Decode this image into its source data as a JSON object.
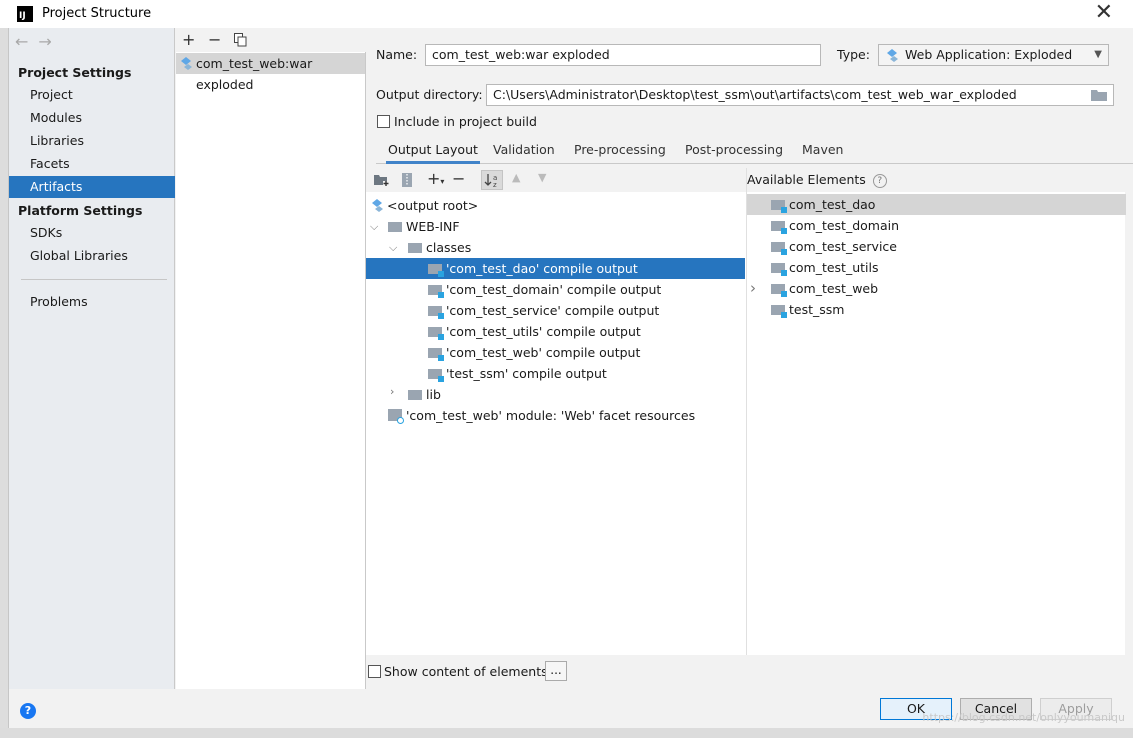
{
  "window": {
    "title": "Project Structure",
    "app_icon_text": "IJ",
    "close_glyph": "✕"
  },
  "sidebar": {
    "nav_back": "←",
    "nav_forward": "→",
    "project_settings_header": "Project Settings",
    "project_items": [
      {
        "label": "Project"
      },
      {
        "label": "Modules"
      },
      {
        "label": "Libraries"
      },
      {
        "label": "Facets"
      },
      {
        "label": "Artifacts",
        "selected": true
      }
    ],
    "platform_settings_header": "Platform Settings",
    "platform_items": [
      {
        "label": "SDKs"
      },
      {
        "label": "Global Libraries"
      }
    ],
    "problems_label": "Problems"
  },
  "artifacts": {
    "add": "+",
    "remove": "−",
    "copy_icon": "copy-icon",
    "items": [
      {
        "label": "com_test_web:war exploded"
      }
    ]
  },
  "details": {
    "name_label": "Name:",
    "name_value": "com_test_web:war exploded",
    "type_label": "Type:",
    "type_value": "Web Application: Exploded",
    "output_dir_label": "Output directory:",
    "output_dir_value": "C:\\Users\\Administrator\\Desktop\\test_ssm\\out\\artifacts\\com_test_web_war_exploded",
    "include_in_build_label": "Include in project build",
    "include_in_build_checked": false
  },
  "tabs": [
    {
      "label": "Output Layout",
      "active": true
    },
    {
      "label": "Validation"
    },
    {
      "label": "Pre-processing"
    },
    {
      "label": "Post-processing"
    },
    {
      "label": "Maven"
    }
  ],
  "layout_tree": {
    "root": "<output root>",
    "web_inf": "WEB-INF",
    "classes": "classes",
    "outputs": [
      {
        "label": "'com_test_dao' compile output",
        "selected": true
      },
      {
        "label": "'com_test_domain' compile output"
      },
      {
        "label": "'com_test_service' compile output"
      },
      {
        "label": "'com_test_utils' compile output"
      },
      {
        "label": "'com_test_web' compile output"
      },
      {
        "label": "'test_ssm' compile output"
      }
    ],
    "lib": "lib",
    "facet_resources": "'com_test_web' module: 'Web' facet resources"
  },
  "available": {
    "header": "Available Elements",
    "help_glyph": "?",
    "items": [
      {
        "label": "com_test_dao",
        "selected": true
      },
      {
        "label": "com_test_domain"
      },
      {
        "label": "com_test_service"
      },
      {
        "label": "com_test_utils"
      },
      {
        "label": "com_test_web",
        "expandable": true
      },
      {
        "label": "test_ssm"
      }
    ]
  },
  "bottom": {
    "show_content_label": "Show content of elements",
    "show_content_checked": false,
    "more_button": "..."
  },
  "footer": {
    "help_glyph": "?",
    "ok": "OK",
    "cancel": "Cancel",
    "apply": "Apply",
    "watermark": "https://blog.csdn.net/onlyyoumaniqu"
  },
  "colors": {
    "selection": "#2675bf",
    "tab_underline": "#4083c9",
    "help_blue": "#1877f2"
  }
}
